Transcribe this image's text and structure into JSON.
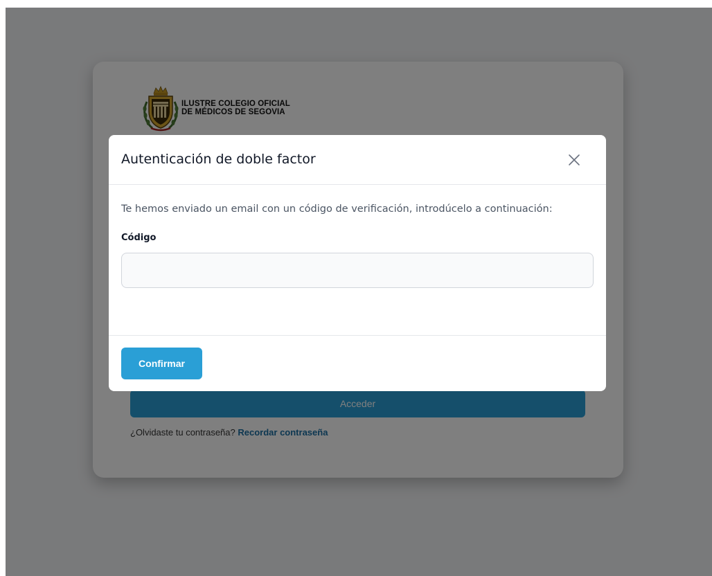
{
  "login": {
    "org_name_line1": "ILUSTRE COLEGIO OFICIAL",
    "org_name_line2": "DE MÉDICOS DE SEGOVIA",
    "acceder_label": "Acceder",
    "forgot_text": "¿Olvidaste tu contraseña?",
    "forgot_link": "Recordar contraseña",
    "crest_icon": "coat-of-arms-logo"
  },
  "modal": {
    "title": "Autenticación de doble factor",
    "close_icon": "close-icon",
    "message": "Te hemos enviado un email con un código de verificación, introdúcelo a continuación:",
    "code_label": "Código",
    "code_value": "",
    "code_placeholder": "",
    "confirm_label": "Confirmar"
  },
  "colors": {
    "primary": "#2a9fd6",
    "link": "#1b6fa3",
    "backdrop": "rgba(0,0,0,0.5)"
  }
}
